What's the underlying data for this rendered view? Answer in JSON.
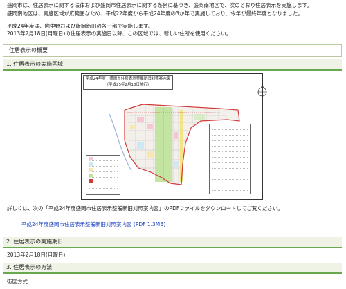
{
  "intro": {
    "line1": "盛岡市は、住居表示に関する法律および盛岡市住居表示に関する条例に基づき、盛岡南地区で、次のとおり住居表示を実施します。",
    "line2": "盛岡南地区は、実施区域が広範囲なため、平成22年度から平成24年度の3か年で実施しており、今年が最終年度となりました。",
    "line3": "平成24年度は、向中野および飯岡新田の各一部で実施します。",
    "line4": "2013年2月18日(月曜日)の住居表示の実施日以降、この区域では、新しい住所を使用ください。"
  },
  "section_main": {
    "title": "住居表示の概要"
  },
  "sec1": {
    "title": "1. 住居表示の実施区域",
    "map": {
      "title_line1": "平成24年度　盛岡市住居表示整備新旧対照案内図",
      "title_line2": "（平成25年2月18日施行）"
    },
    "detail": "詳しくは、次の「平成24年度盛岡市住居表示整備新旧対照案内図」のPDFファイルをダウンロードしてご覧ください。",
    "link": "平成24年度盛岡市住居表示整備新旧対照案内図 (PDF 1.3MB)"
  },
  "sec2": {
    "title": "2. 住居表示の実施期日",
    "date": "2013年2月18日(月曜日)"
  },
  "sec3": {
    "title": "3. 住居表示の方法",
    "sub": "街区方式"
  },
  "colors": {
    "accent": "#6aa84f",
    "link": "#1a3fbf",
    "boundary": "#d23a3a"
  }
}
